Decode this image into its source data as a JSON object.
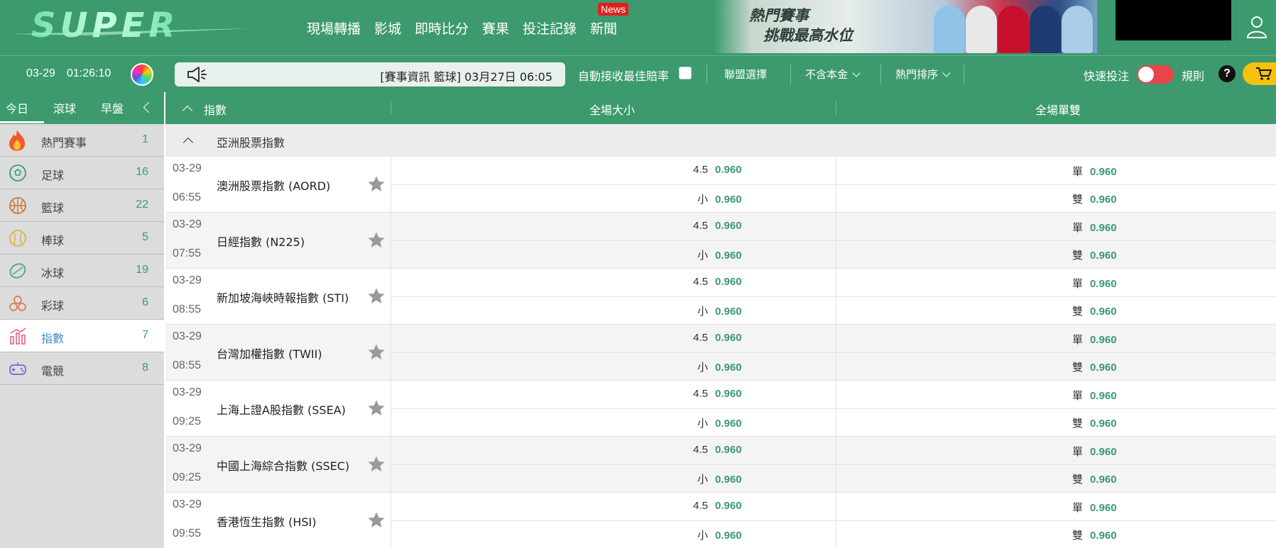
{
  "header": {
    "logo_text": "SUPER",
    "nav": [
      "現場轉播",
      "影城",
      "即時比分",
      "賽果",
      "投注記錄",
      "新聞"
    ],
    "news_badge": "News",
    "banner_line1": "熱門賽事",
    "banner_line2": "挑戰最高水位"
  },
  "toolbar": {
    "date": "03-29",
    "time": "01:26:10",
    "marquee_text": "[賽事資訊 籃球] 03月27日 06:05",
    "auto_accept_label": "自動接收最佳賠率",
    "league_select": "聯盟選擇",
    "principal_select": "不含本金",
    "sort_select": "熱門排序",
    "quick_bet_label": "快速投注",
    "rules_label": "規則",
    "help_symbol": "?"
  },
  "sidebar": {
    "tabs": [
      "今日",
      "滾球",
      "早盤"
    ],
    "sports": [
      {
        "name": "熱門賽事",
        "count": "1",
        "icon": "fire-icon"
      },
      {
        "name": "足球",
        "count": "16",
        "icon": "soccer-ball-icon"
      },
      {
        "name": "籃球",
        "count": "22",
        "icon": "basketball-icon"
      },
      {
        "name": "棒球",
        "count": "5",
        "icon": "baseball-icon"
      },
      {
        "name": "冰球",
        "count": "19",
        "icon": "ice-hockey-icon"
      },
      {
        "name": "彩球",
        "count": "6",
        "icon": "lottery-balls-icon"
      },
      {
        "name": "指數",
        "count": "7",
        "icon": "index-chart-icon"
      },
      {
        "name": "電競",
        "count": "8",
        "icon": "gamepad-icon"
      }
    ]
  },
  "table": {
    "col_event": "指數",
    "col_over_under": "全場大小",
    "col_odd_even": "全場單雙",
    "league": "亞洲股票指數",
    "matches": [
      {
        "date": "03-29",
        "time": "06:55",
        "name": "澳洲股票指數 (AORD)",
        "ou_line": "4.5",
        "over_odds": "0.960",
        "under_label": "小",
        "under_odds": "0.960",
        "odd_label": "單",
        "odd_odds": "0.960",
        "even_label": "雙",
        "even_odds": "0.960"
      },
      {
        "date": "03-29",
        "time": "07:55",
        "name": "日經指數 (N225)",
        "ou_line": "4.5",
        "over_odds": "0.960",
        "under_label": "小",
        "under_odds": "0.960",
        "odd_label": "單",
        "odd_odds": "0.960",
        "even_label": "雙",
        "even_odds": "0.960"
      },
      {
        "date": "03-29",
        "time": "08:55",
        "name": "新加坡海峽時報指數 (STI)",
        "ou_line": "4.5",
        "over_odds": "0.960",
        "under_label": "小",
        "under_odds": "0.960",
        "odd_label": "單",
        "odd_odds": "0.960",
        "even_label": "雙",
        "even_odds": "0.960"
      },
      {
        "date": "03-29",
        "time": "08:55",
        "name": "台灣加權指數 (TWII)",
        "ou_line": "4.5",
        "over_odds": "0.960",
        "under_label": "小",
        "under_odds": "0.960",
        "odd_label": "單",
        "odd_odds": "0.960",
        "even_label": "雙",
        "even_odds": "0.960"
      },
      {
        "date": "03-29",
        "time": "09:25",
        "name": "上海上證A股指數 (SSEA)",
        "ou_line": "4.5",
        "over_odds": "0.960",
        "under_label": "小",
        "under_odds": "0.960",
        "odd_label": "單",
        "odd_odds": "0.960",
        "even_label": "雙",
        "even_odds": "0.960"
      },
      {
        "date": "03-29",
        "time": "09:25",
        "name": "中國上海綜合指數 (SSEC)",
        "ou_line": "4.5",
        "over_odds": "0.960",
        "under_label": "小",
        "under_odds": "0.960",
        "odd_label": "單",
        "odd_odds": "0.960",
        "even_label": "雙",
        "even_odds": "0.960"
      },
      {
        "date": "03-29",
        "time": "09:55",
        "name": "香港恆生指數 (HSI)",
        "ou_line": "4.5",
        "over_odds": "0.960",
        "under_label": "小",
        "under_odds": "0.960",
        "odd_label": "單",
        "odd_odds": "0.960",
        "even_label": "雙",
        "even_odds": "0.960"
      }
    ]
  },
  "colors": {
    "brand_green": "#3c9a6e",
    "odds_green": "#3c9a6e",
    "active_blue": "#3d8ec9",
    "news_red": "#e02020",
    "cart_yellow": "#f4c20d",
    "toggle_red": "#e8454a"
  }
}
